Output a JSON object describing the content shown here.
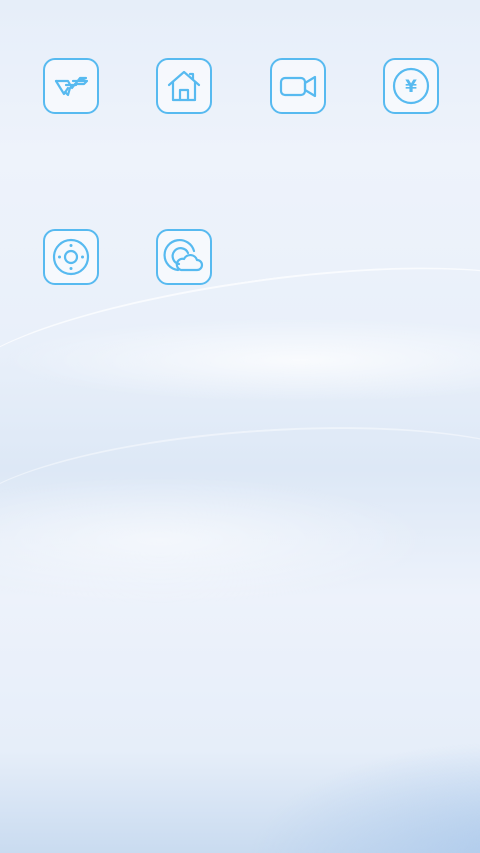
{
  "home_screen": {
    "background": {
      "accent": "#57baf0",
      "top": "#e6eef9",
      "bottom": "#c9dbf0"
    },
    "rows": [
      {
        "apps": [
          {
            "name": "cf-logo-icon"
          },
          {
            "name": "home-icon"
          },
          {
            "name": "video-camera-icon"
          },
          {
            "name": "yen-coin-icon",
            "glyph_text": "¥"
          }
        ]
      },
      {
        "apps": [
          {
            "name": "remote-control-icon"
          },
          {
            "name": "weather-cloud-icon"
          }
        ]
      }
    ]
  }
}
